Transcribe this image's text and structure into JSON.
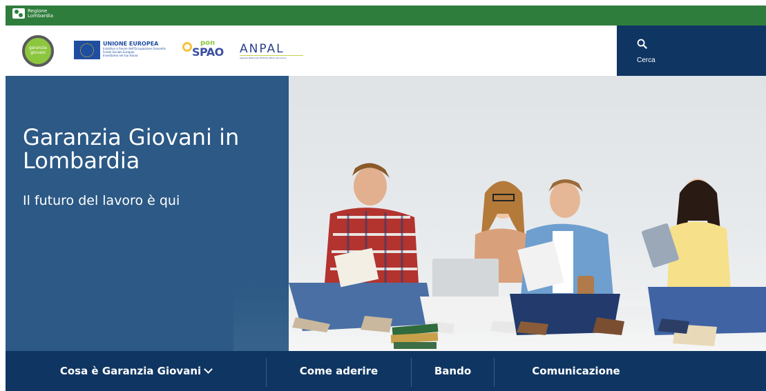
{
  "topbar": {
    "logo_text_1": "Regione",
    "logo_text_2": "Lombardia"
  },
  "header": {
    "gg_logo_text": "garanzia giovani",
    "eu_title": "UNIONE EUROPEA",
    "eu_sub_1": "Iniziativa a favore dell'Occupazione Giovanile",
    "eu_sub_2": "Fondo Sociale Europeo",
    "eu_sub_3": "Investiamo nel tuo futuro",
    "pon_small": "pon",
    "pon_big": "SPAO",
    "anpal_word": "ANPAL",
    "anpal_sub": "Agenzia Nazionale Politiche Attive del Lavoro"
  },
  "search": {
    "label": "Cerca"
  },
  "hero": {
    "title": "Garanzia Giovani in Lombardia",
    "subtitle": "Il futuro del lavoro è qui"
  },
  "nav": {
    "items": [
      {
        "label": "Cosa è Garanzia Giovani"
      },
      {
        "label": "Come aderire"
      },
      {
        "label": "Bando"
      },
      {
        "label": "Comunicazione"
      }
    ]
  },
  "colors": {
    "topbar_green": "#2f7d3c",
    "navy": "#0f3562",
    "hero_blue": "#2c5985"
  }
}
